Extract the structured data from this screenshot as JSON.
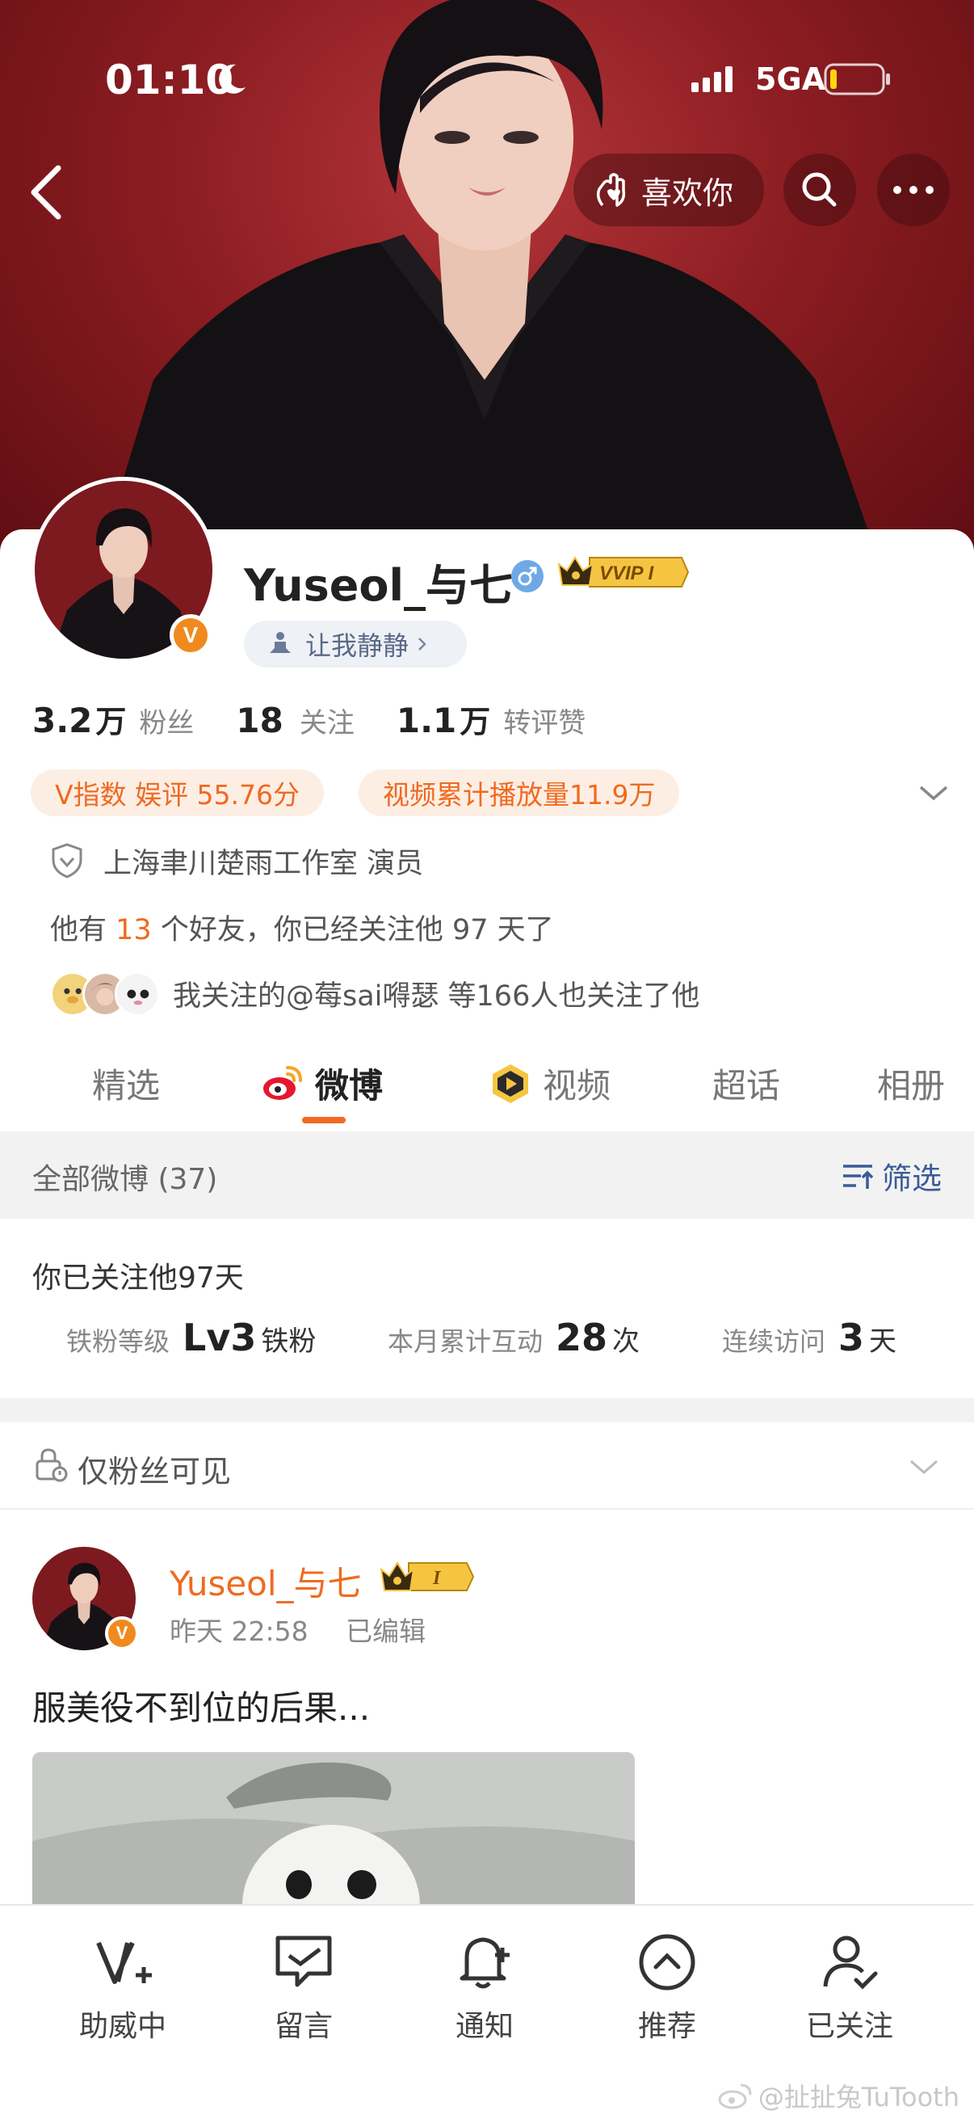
{
  "status_bar": {
    "time": "01:10",
    "network": "5GA"
  },
  "header": {
    "like_label": "喜欢你"
  },
  "profile": {
    "username": "Yuseol_与七",
    "vip_label": "VVIP I",
    "status_text": "让我静静",
    "stats": [
      {
        "num": "3.2",
        "unit": "万",
        "label": "粉丝"
      },
      {
        "num": "18",
        "unit": "",
        "label": "关注"
      },
      {
        "num": "1.1",
        "unit": "万",
        "label": "转评赞"
      }
    ],
    "tags": [
      "V指数 娱评 55.76分",
      "视频累计播放量11.9万"
    ],
    "certification": "上海聿川楚雨工作室 演员",
    "friends": {
      "prefix": "他有 ",
      "count": "13",
      "suffix": " 个好友，你已经关注他 97 天了"
    },
    "common_follow_text": "我关注的@莓sai嘚瑟  等166人也关注了他"
  },
  "tabs": [
    {
      "label": "精选",
      "active": false
    },
    {
      "label": "微博",
      "active": true
    },
    {
      "label": "视频",
      "active": false
    },
    {
      "label": "超话",
      "active": false
    },
    {
      "label": "相册",
      "active": false
    }
  ],
  "feed_header": {
    "all_posts": "全部微博 (37)",
    "filter": "筛选"
  },
  "fan_card": {
    "title": "你已关注他97天",
    "items": [
      {
        "label": "铁粉等级",
        "value": "Lv3",
        "unit": "铁粉"
      },
      {
        "label": "本月累计互动",
        "value": "28",
        "unit": "次"
      },
      {
        "label": "连续访问",
        "value": "3",
        "unit": "天"
      }
    ]
  },
  "fans_only": "仅粉丝可见",
  "post": {
    "author": "Yuseol_与七",
    "time": "昨天 22:58",
    "edited": "已编辑",
    "text": "服美役不到位的后果..."
  },
  "bottom_bar": [
    {
      "label": "助威中",
      "icon": "v-plus-icon"
    },
    {
      "label": "留言",
      "icon": "message-icon"
    },
    {
      "label": "通知",
      "icon": "bell-plus-icon"
    },
    {
      "label": "推荐",
      "icon": "chevron-up-circle-icon"
    },
    {
      "label": "已关注",
      "icon": "user-check-icon"
    }
  ],
  "watermark": "@扯扯兔TuTooth",
  "colors": {
    "accent": "#f06a20",
    "link_blue": "#3b5b96",
    "cover_red": "#8c1d22"
  }
}
